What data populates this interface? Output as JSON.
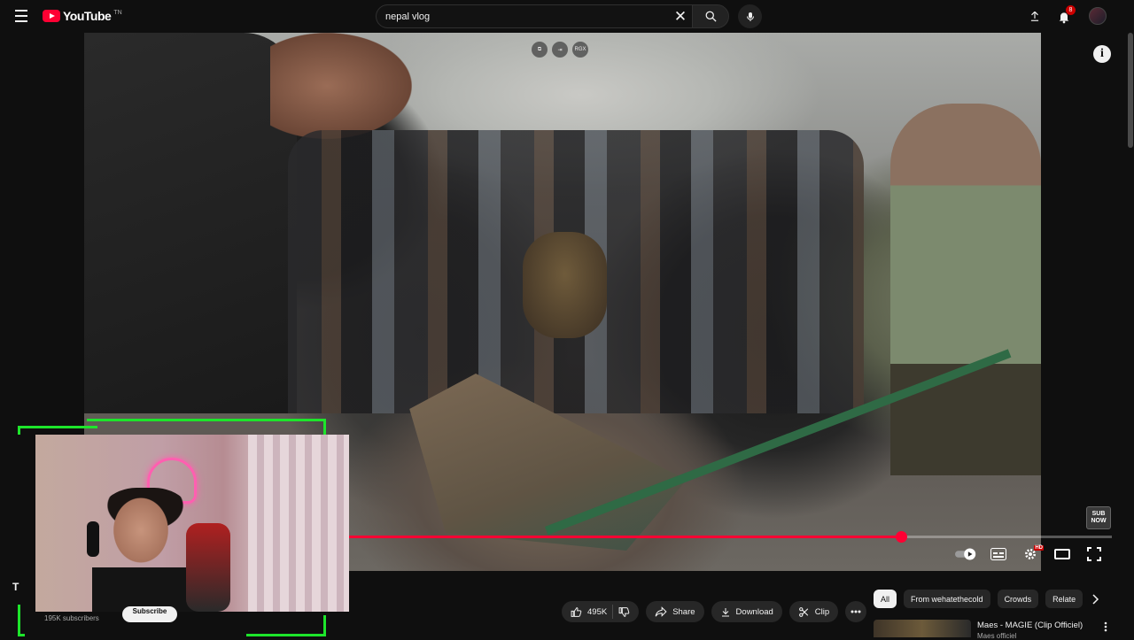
{
  "header": {
    "logo_text": "YouTube",
    "logo_sup": "TN",
    "search": {
      "value": "nepal vlog",
      "placeholder": "Search"
    },
    "notifications_count": "8"
  },
  "player": {
    "overlay_icons": [
      "",
      "",
      "RGX"
    ],
    "progress": 0.73,
    "sub_sticker": "SUB NOW",
    "hd_label": "HD"
  },
  "channel": {
    "title_fragment": "T",
    "subscribers": "195K subscribers",
    "subscribe_label": "Subscribe"
  },
  "actions": {
    "likes": "495K",
    "share": "Share",
    "download": "Download",
    "clip": "Clip"
  },
  "chips": [
    "All",
    "From wehatethecold",
    "Crowds",
    "Relate"
  ],
  "recommendation": {
    "title": "Maes - MAGIE (Clip Officiel)",
    "channel": "Maes officiel"
  },
  "colors": {
    "accent": "#ff0033",
    "neon": "#1de52b",
    "background": "#0f0f0f"
  }
}
